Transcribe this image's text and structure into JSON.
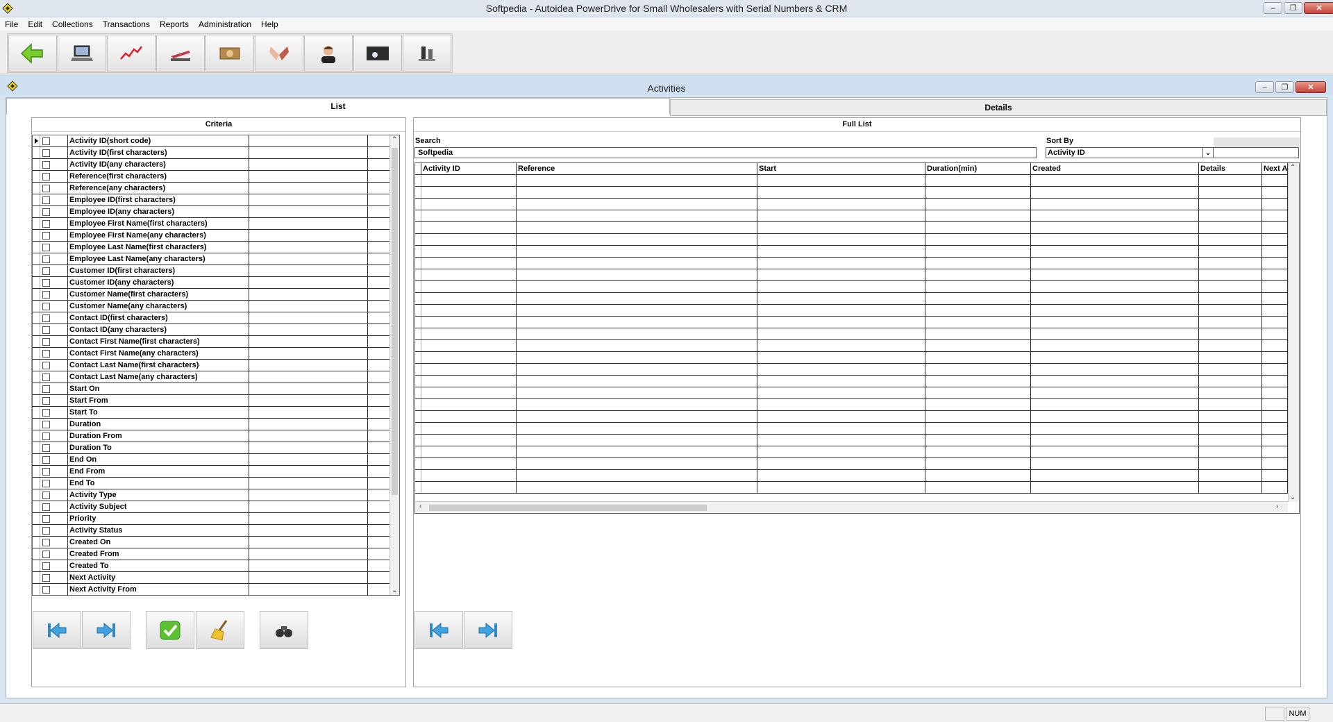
{
  "window": {
    "title": "Softpedia - Autoidea PowerDrive for Small Wholesalers with Serial Numbers & CRM",
    "controls": {
      "minimize": "‒",
      "restore": "❐",
      "close": "✕"
    }
  },
  "menu": {
    "items": [
      "File",
      "Edit",
      "Collections",
      "Transactions",
      "Reports",
      "Administration",
      "Help"
    ]
  },
  "toolbar": {
    "buttons": [
      {
        "name": "back",
        "icon": "green-arrow-left-icon"
      },
      {
        "name": "pos",
        "icon": "laptop-icon"
      },
      {
        "name": "sales",
        "icon": "chart-icon"
      },
      {
        "name": "stapler",
        "icon": "stapler-icon"
      },
      {
        "name": "money",
        "icon": "money-icon"
      },
      {
        "name": "handshake",
        "icon": "handshake-icon"
      },
      {
        "name": "support",
        "icon": "headset-person-icon"
      },
      {
        "name": "keyboard",
        "icon": "keyboard-icon"
      },
      {
        "name": "meeting",
        "icon": "people-icon"
      }
    ]
  },
  "child": {
    "title": "Activities",
    "controls": {
      "minimize": "‒",
      "restore": "❐",
      "close": "✕"
    }
  },
  "tabs": {
    "list": "List",
    "details": "Details"
  },
  "criteria": {
    "header": "Criteria",
    "rows": [
      "Activity ID(short code)",
      "Activity ID(first characters)",
      "Activity ID(any characters)",
      "Reference(first characters)",
      "Reference(any characters)",
      "Employee ID(first characters)",
      "Employee ID(any characters)",
      "Employee First Name(first characters)",
      "Employee First Name(any characters)",
      "Employee Last Name(first characters)",
      "Employee Last Name(any characters)",
      "Customer ID(first characters)",
      "Customer ID(any characters)",
      "Customer Name(first characters)",
      "Customer Name(any characters)",
      "Contact ID(first characters)",
      "Contact ID(any characters)",
      "Contact First Name(first characters)",
      "Contact First Name(any characters)",
      "Contact Last Name(first characters)",
      "Contact Last Name(any characters)",
      "Start On",
      "Start From",
      "Start To",
      "Duration",
      "Duration From",
      "Duration To",
      "End On",
      "End From",
      "End To",
      "Activity Type",
      "Activity Subject",
      "Priority",
      "Activity Status",
      "Created On",
      "Created From",
      "Created To",
      "Next Activity",
      "Next Activity From"
    ]
  },
  "fulllist": {
    "header": "Full List",
    "search_label": "Search",
    "search_value": "Softpedia",
    "sortby_label": "Sort By",
    "sortby_value": "Activity ID",
    "columns": [
      "Activity ID",
      "Reference",
      "Start",
      "Duration(min)",
      "Created",
      "Details",
      "Next A"
    ]
  },
  "statusbar": {
    "num": "NUM"
  }
}
